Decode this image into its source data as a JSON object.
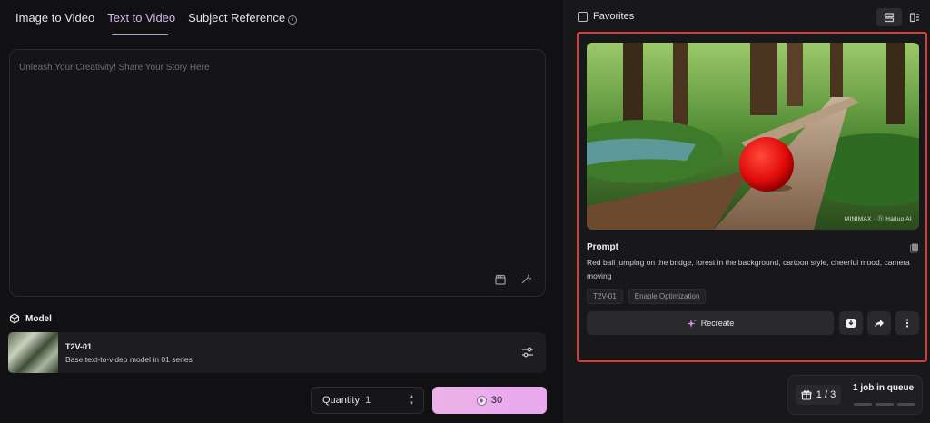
{
  "tabs": [
    {
      "label": "Image to Video"
    },
    {
      "label": "Text to Video"
    },
    {
      "label": "Subject Reference"
    }
  ],
  "prompt_box": {
    "placeholder": "Unleash Your Creativity! Share Your Story Here",
    "value": ""
  },
  "model": {
    "section_label": "Model",
    "name": "T2V-01",
    "description": "Base text-to-video model in 01 series"
  },
  "quantity": {
    "label": "Quantity:",
    "value": "1"
  },
  "generate": {
    "cost": "30"
  },
  "right_panel": {
    "favorites_label": "Favorites",
    "card": {
      "watermark": "MINIMAX · ⓗ Hailuo AI",
      "prompt_title": "Prompt",
      "prompt_text": "Red ball jumping on the bridge, forest in the background, cartoon style, cheerful mood, camera moving",
      "tags": [
        "T2V-01",
        "Enable Optimization"
      ],
      "recreate_label": "Recreate"
    }
  },
  "queue": {
    "count": "1 / 3",
    "text": "1 job in queue"
  },
  "colors": {
    "accent": "#d9b6f0",
    "highlight_border": "#e03a36",
    "generate_button": "#e9a8f0"
  }
}
